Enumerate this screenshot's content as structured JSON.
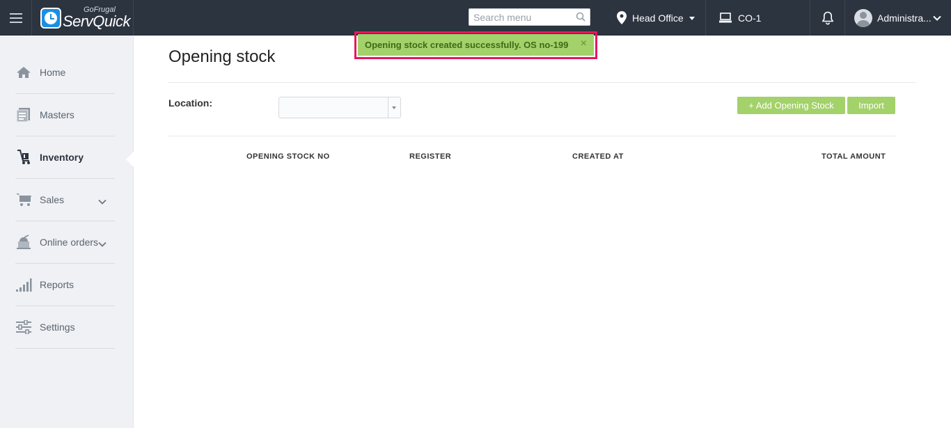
{
  "header": {
    "logo_small": "GoFrugal",
    "logo_big": "ServQuick",
    "search_placeholder": "Search menu",
    "location": "Head Office",
    "register": "CO-1",
    "user": "Administra..."
  },
  "sidebar": {
    "items": [
      {
        "label": "Home",
        "icon": "home-icon"
      },
      {
        "label": "Masters",
        "icon": "masters-icon"
      },
      {
        "label": "Inventory",
        "icon": "inventory-icon",
        "active": true
      },
      {
        "label": "Sales",
        "icon": "cart-icon",
        "expandable": true
      },
      {
        "label": "Online orders",
        "icon": "online-orders-icon",
        "expandable": true
      },
      {
        "label": "Reports",
        "icon": "reports-icon"
      },
      {
        "label": "Settings",
        "icon": "settings-icon"
      }
    ]
  },
  "main": {
    "title": "Opening stock",
    "location_label": "Location:",
    "location_value": "",
    "add_button": "+ Add Opening Stock",
    "import_button": "Import",
    "columns": [
      "OPENING STOCK NO",
      "REGISTER",
      "CREATED AT",
      "TOTAL AMOUNT"
    ]
  },
  "toast": {
    "message": "Opening stock created successfully. OS no-199",
    "close": "×"
  },
  "colors": {
    "topbar": "#2c3440",
    "accent_green": "#a3d16a",
    "highlight": "#e6175c"
  }
}
